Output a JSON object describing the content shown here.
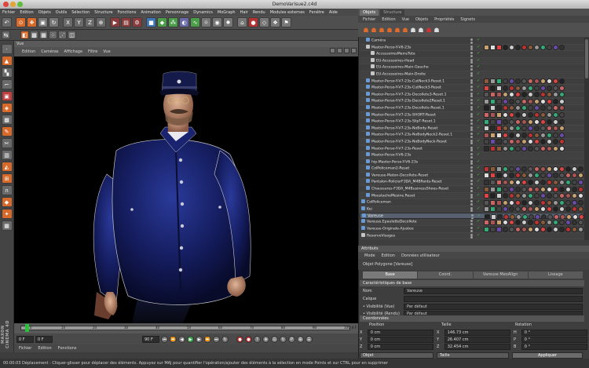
{
  "window": {
    "title": "DemoVarisue2.c4d"
  },
  "menubar": [
    "Fichier",
    "Edition",
    "Objets",
    "Outils",
    "Sélection",
    "Structure",
    "Fonctions",
    "Animation",
    "Personnage",
    "Dynamics",
    "MoGraph",
    "Hair",
    "Rendu",
    "Modules externes",
    "Fenêtre",
    "Aide"
  ],
  "viewport": {
    "header": "Vue",
    "menu": [
      "Edition",
      "Caméras",
      "Affichage",
      "Filtre",
      "Vue"
    ]
  },
  "timeline": {
    "ticks": [
      "0",
      "10",
      "20",
      "30",
      "40",
      "50",
      "60",
      "70",
      "80",
      "90",
      "100"
    ],
    "end_label": "0 F"
  },
  "transport": {
    "current": "0 F",
    "end": "90 F",
    "fps": "F"
  },
  "status": "00:00:03   Déplacement : Cliquer-glisser pour déplacer des éléments. Appuyez sur MAJ pour quantifier l'opération/ajouter des éléments à la sélection en mode Points et sur CTRL pour en supprimer",
  "object_manager": {
    "tabs": [
      "Objets",
      "Structure"
    ],
    "menu": [
      "Fichier",
      "Edition",
      "Vue",
      "Objets",
      "Propriétés",
      "Signets"
    ],
    "objects": [
      {
        "name": "Caméra",
        "indent": 1,
        "ico": "#6a9ad6"
      },
      {
        "name": "Master-Perso-Y-V6-23s",
        "indent": 1,
        "ico": "#c6c6c6"
      },
      {
        "name": "AccessoiresMainsTete",
        "indent": 2,
        "ico": "#c6c6c6"
      },
      {
        "name": "EU-Accessoires-Head",
        "indent": 2,
        "ico": "#c6c6c6"
      },
      {
        "name": "EU-Accessoires-Main-Gauche",
        "indent": 2,
        "ico": "#c6c6c6"
      },
      {
        "name": "EU-Accessoires-Main-Droite",
        "indent": 2,
        "ico": "#c6c6c6"
      },
      {
        "name": "Master-Perso-Y-V7-23s-CutNeck3-Reset.1",
        "indent": 1,
        "ico": "#6a9ad6"
      },
      {
        "name": "Master-Perso-Y-V7-23s-CutNeck3-Reset",
        "indent": 1,
        "ico": "#6a9ad6"
      },
      {
        "name": "Master-Perso-Y-V7-23s-Decollete3-Reset.1",
        "indent": 1,
        "ico": "#6a9ad6"
      },
      {
        "name": "Master-Perso-Y-V7-23s-Decollete2Reset.1",
        "indent": 1,
        "ico": "#6a9ad6"
      },
      {
        "name": "Master-Perso-Y-V7-23s-Decollete-Reset.1",
        "indent": 1,
        "ico": "#6a9ad6"
      },
      {
        "name": "Master-Perso-Y-V7-23s-SHORT-Reset",
        "indent": 1,
        "ico": "#6a9ad6"
      },
      {
        "name": "Master-Perso-Y-V7-23s-SlipT-Reset.1",
        "indent": 1,
        "ico": "#6a9ad6"
      },
      {
        "name": "Master-Perso-Y-V7-23s-NoBody-Reset",
        "indent": 1,
        "ico": "#6a9ad6"
      },
      {
        "name": "Master-Perso-Y-V7-23s-NoBodyNeck2-Reset.1",
        "indent": 1,
        "ico": "#6a9ad6"
      },
      {
        "name": "Master-Perso-Y-V7-23s-NoBodyNeck-Reset",
        "indent": 1,
        "ico": "#6a9ad6"
      },
      {
        "name": "Master-Perso-Y-V7-23s-Reset",
        "indent": 1,
        "ico": "#6a9ad6"
      },
      {
        "name": "Master-Perso-Y-V6-23s",
        "indent": 1,
        "ico": "#6a9ad6"
      },
      {
        "name": "hip-Master-Perso-Y-V6-23s",
        "indent": 1,
        "ico": "#6a9ad6"
      },
      {
        "name": "ColPoliceman2-Reset",
        "indent": 1,
        "ico": "#6a9ad6"
      },
      {
        "name": "Vareuse-Maton-Decollete-Reset",
        "indent": 1,
        "ico": "#6a9ad6"
      },
      {
        "name": "Pantalon-PolicierF3DA_M4BPants-Reset",
        "indent": 1,
        "ico": "#6a9ad6"
      },
      {
        "name": "Chaussures-F3DA_M4BusinessShoes-Reset",
        "indent": 1,
        "ico": "#6a9ad6"
      },
      {
        "name": "MoustacheMesine.Reset",
        "indent": 1,
        "ico": "#6a9ad6"
      },
      {
        "name": "ColPoliceman",
        "indent": 0,
        "ico": "#6a9ad6"
      },
      {
        "name": "Kei",
        "indent": 0,
        "ico": "#6a9ad6"
      },
      {
        "name": "Vareuse",
        "indent": 0,
        "ico": "#6a9ad6"
      },
      {
        "name": "Vareuse.EpauletteDecollete",
        "indent": 0,
        "ico": "#6a9ad6"
      },
      {
        "name": "Vareuse-Originale-Ajustee",
        "indent": 0,
        "ico": "#6a9ad6"
      },
      {
        "name": "ReserveVisages",
        "indent": 0,
        "ico": "#c6c6c6"
      }
    ]
  },
  "attributes": {
    "title": "Attributs",
    "menu": [
      "Mode",
      "Edition",
      "Données utilisateur"
    ],
    "object_label": "Objet Polygone [Vareuse]",
    "tabs": [
      "Base",
      "Coord.",
      "Vareuse MeoAlign",
      "Lissage"
    ],
    "section": "Caractéristiques de base",
    "props": [
      {
        "label": "Nom",
        "value": "Vareuse"
      },
      {
        "label": "Calque",
        "value": ""
      },
      {
        "label": "• Visibilité (Vue)",
        "value": "Par défaut"
      },
      {
        "label": "• Visibilité (Rendu)",
        "value": "Par défaut"
      }
    ]
  },
  "coordinates": {
    "title": "Coordonnées",
    "headers": [
      "Position",
      "Taille",
      "Rotation"
    ],
    "rows": [
      {
        "axis": "X",
        "pos": "0 cm",
        "size": "146.73 cm",
        "rot_axis": "H",
        "rot": "0 °"
      },
      {
        "axis": "Y",
        "pos": "0 cm",
        "size": "26.407 cm",
        "rot_axis": "P",
        "rot": "0 °"
      },
      {
        "axis": "Z",
        "pos": "0 cm",
        "size": "32.454 cm",
        "rot_axis": "B",
        "rot": "0 °"
      }
    ],
    "mode": "Objet",
    "size_mode": "Taille",
    "apply": "Appliquer"
  },
  "branding": "MAXON CINEMA 4D"
}
